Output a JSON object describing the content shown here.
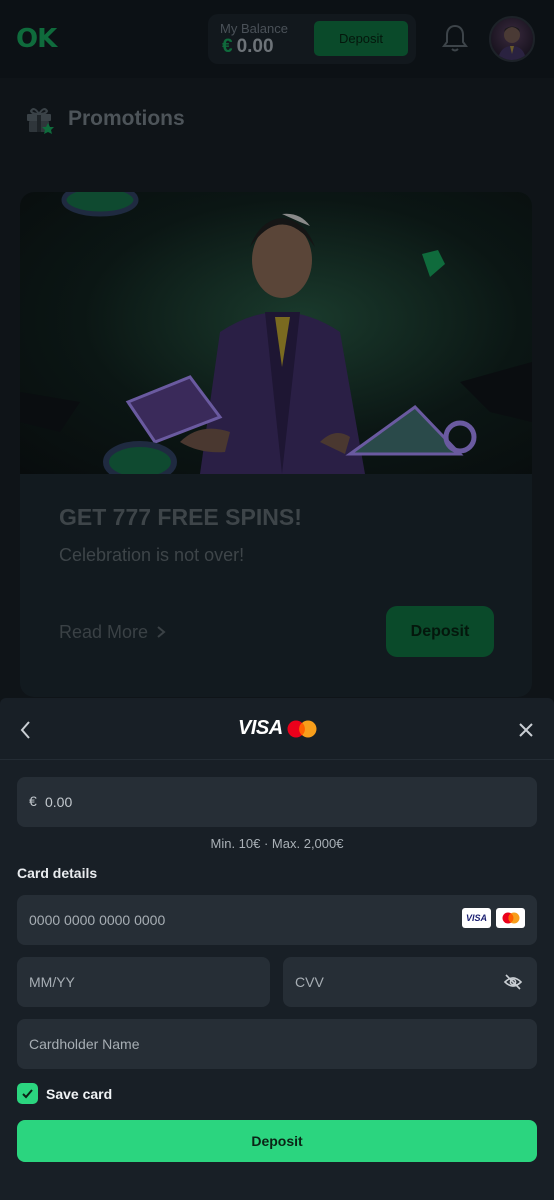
{
  "header": {
    "logo_text": "OK",
    "balance_label": "My Balance",
    "balance_currency": "€",
    "balance_amount": "0.00",
    "deposit_label": "Deposit",
    "icons": [
      "bell-icon",
      "avatar"
    ]
  },
  "promotions": {
    "title": "Promotions",
    "card": {
      "heading": "GET 777 FREE SPINS!",
      "subheading": "Celebration is not over!",
      "read_more": "Read More",
      "deposit_label": "Deposit"
    }
  },
  "deposit_sheet": {
    "brand_visa": "VISA",
    "amount": {
      "currency": "€",
      "placeholder": "0.00"
    },
    "limits_text": "Min. 10€ · Max. 2,000€",
    "card_details_label": "Card details",
    "card_number_placeholder": "0000 0000 0000 0000",
    "mini_visa": "VISA",
    "expiry_placeholder": "MM/YY",
    "cvv_placeholder": "CVV",
    "cardholder_placeholder": "Cardholder Name",
    "save_card_label": "Save card",
    "save_card_checked": true,
    "deposit_label": "Deposit"
  },
  "colors": {
    "accent_green": "#2bd57f",
    "sheet_bg": "#181f26",
    "field_bg": "#262e36"
  }
}
